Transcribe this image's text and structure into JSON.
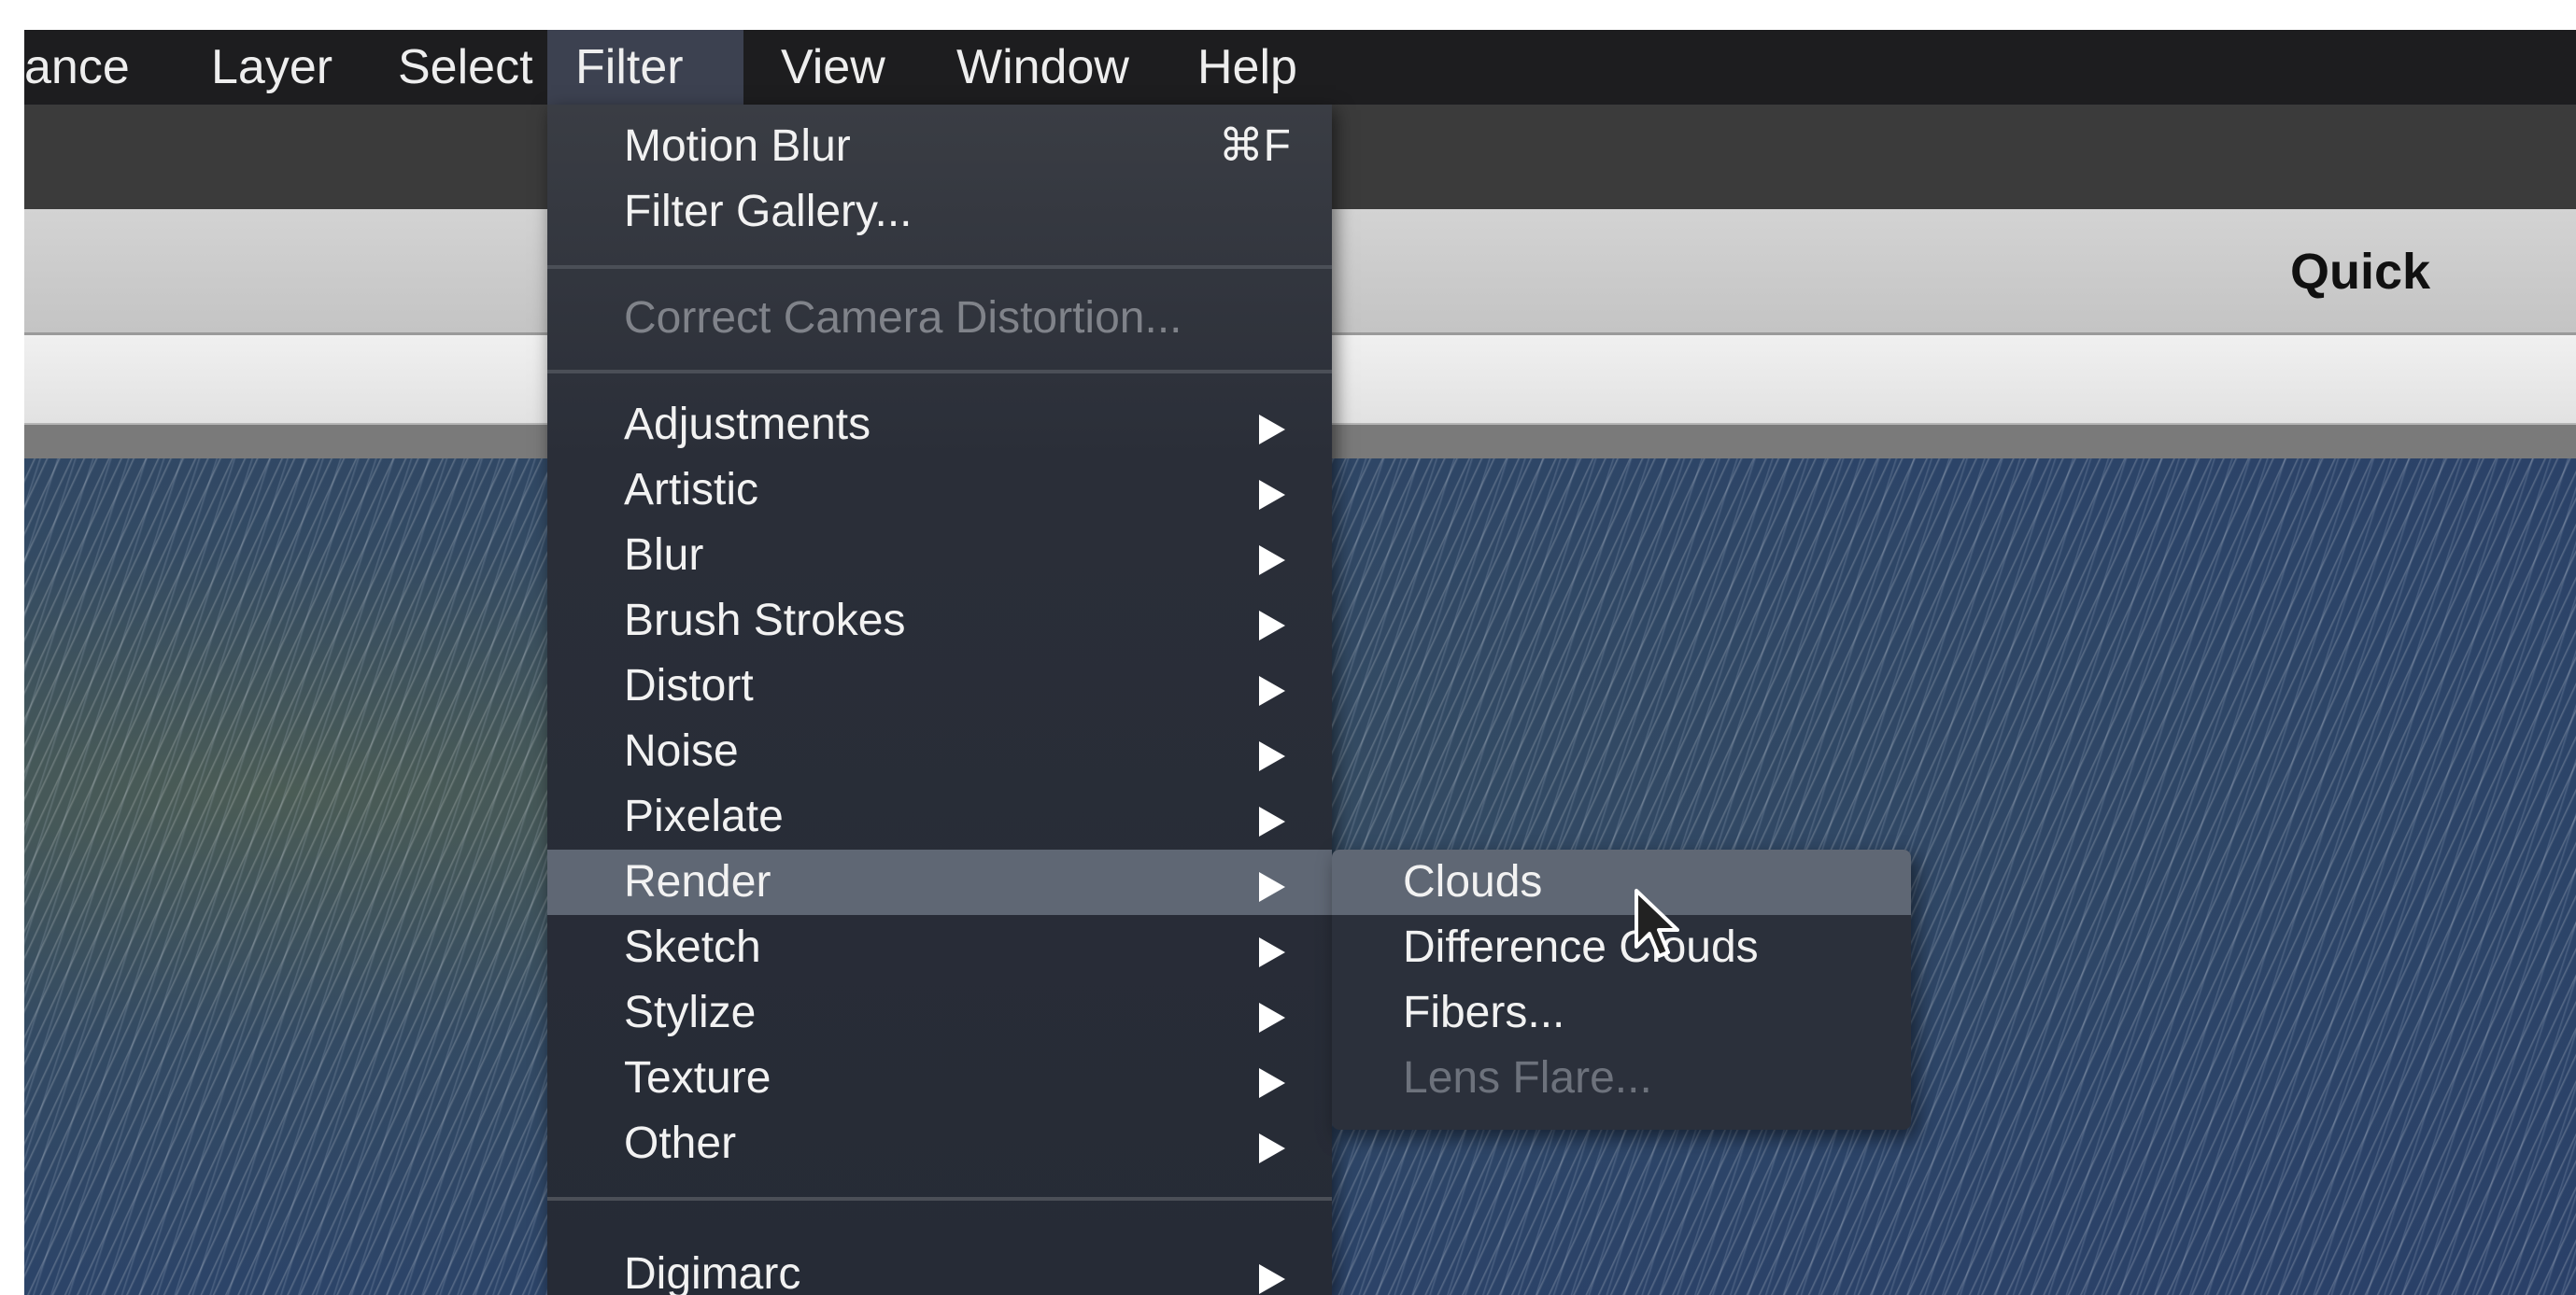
{
  "menubar": {
    "items": [
      {
        "label": "ance"
      },
      {
        "label": "Layer"
      },
      {
        "label": "Select"
      },
      {
        "label": "Filter"
      },
      {
        "label": "View"
      },
      {
        "label": "Window"
      },
      {
        "label": "Help"
      }
    ],
    "active": "Filter"
  },
  "toolbar": {
    "quick_label": "Quick"
  },
  "filter_menu": {
    "group1": [
      {
        "label": "Motion Blur",
        "shortcut": "⌘F"
      },
      {
        "label": "Filter Gallery..."
      }
    ],
    "group2": [
      {
        "label": "Correct Camera Distortion...",
        "disabled": true
      }
    ],
    "group3": [
      {
        "label": "Adjustments",
        "submenu": true
      },
      {
        "label": "Artistic",
        "submenu": true
      },
      {
        "label": "Blur",
        "submenu": true
      },
      {
        "label": "Brush Strokes",
        "submenu": true
      },
      {
        "label": "Distort",
        "submenu": true
      },
      {
        "label": "Noise",
        "submenu": true
      },
      {
        "label": "Pixelate",
        "submenu": true
      },
      {
        "label": "Render",
        "submenu": true,
        "highlighted": true
      },
      {
        "label": "Sketch",
        "submenu": true
      },
      {
        "label": "Stylize",
        "submenu": true
      },
      {
        "label": "Texture",
        "submenu": true
      },
      {
        "label": "Other",
        "submenu": true
      }
    ],
    "group4": [
      {
        "label": "Digimarc",
        "submenu": true
      }
    ]
  },
  "render_submenu": {
    "items": [
      {
        "label": "Clouds",
        "highlighted": true
      },
      {
        "label": "Difference Clouds"
      },
      {
        "label": "Fibers..."
      },
      {
        "label": "Lens Flare...",
        "disabled": true
      }
    ]
  },
  "icons": {
    "submenu_arrow": "chevron-right-icon",
    "cursor": "mouse-pointer-icon"
  },
  "colors": {
    "menu_bg": "#2a2e38",
    "highlight": "#5f6774",
    "disabled_text": "#80838a"
  }
}
